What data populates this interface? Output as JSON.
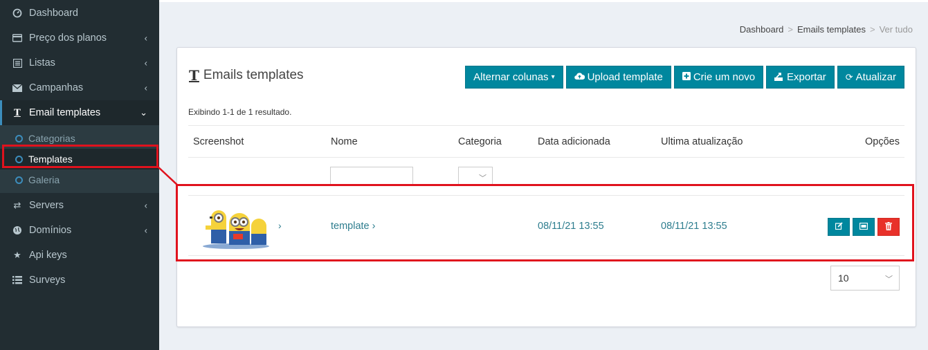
{
  "sidebar": {
    "items": [
      {
        "label": "Dashboard",
        "icon": "gauge-icon"
      },
      {
        "label": "Preço dos planos",
        "icon": "credit-card-icon"
      },
      {
        "label": "Listas",
        "icon": "list-icon"
      },
      {
        "label": "Campanhas",
        "icon": "envelope-icon"
      },
      {
        "label": "Email templates",
        "icon": "text-icon"
      },
      {
        "label": "Servers",
        "icon": "exchange-icon"
      },
      {
        "label": "Domínios",
        "icon": "globe-icon"
      },
      {
        "label": "Api keys",
        "icon": "star-icon"
      },
      {
        "label": "Surveys",
        "icon": "list-lines-icon"
      }
    ],
    "submenu": [
      {
        "label": "Categorias"
      },
      {
        "label": "Templates"
      },
      {
        "label": "Galeria"
      }
    ]
  },
  "breadcrumb": {
    "items": [
      "Dashboard",
      "Emails templates",
      "Ver tudo"
    ],
    "sep": ">"
  },
  "box": {
    "title": "Emails templates",
    "toolbar": {
      "toggle_columns": "Alternar colunas",
      "upload": "Upload template",
      "create": "Crie um novo",
      "export": "Exportar",
      "refresh": "Atualizar"
    },
    "summary": "Exibindo 1-1 de 1 resultado."
  },
  "table": {
    "headers": [
      "Screenshot",
      "Nome",
      "Categoria",
      "Data adicionada",
      "Ultima atualização",
      "Opções"
    ],
    "rows": [
      {
        "name": "template ›",
        "date_added": "08/11/21 13:55",
        "last_updated": "08/11/21 13:55"
      }
    ],
    "page_size": "10"
  },
  "colors": {
    "accent": "#00879e",
    "danger": "#e8312a",
    "highlight": "#e0121d",
    "sidebar": "#222d32"
  }
}
